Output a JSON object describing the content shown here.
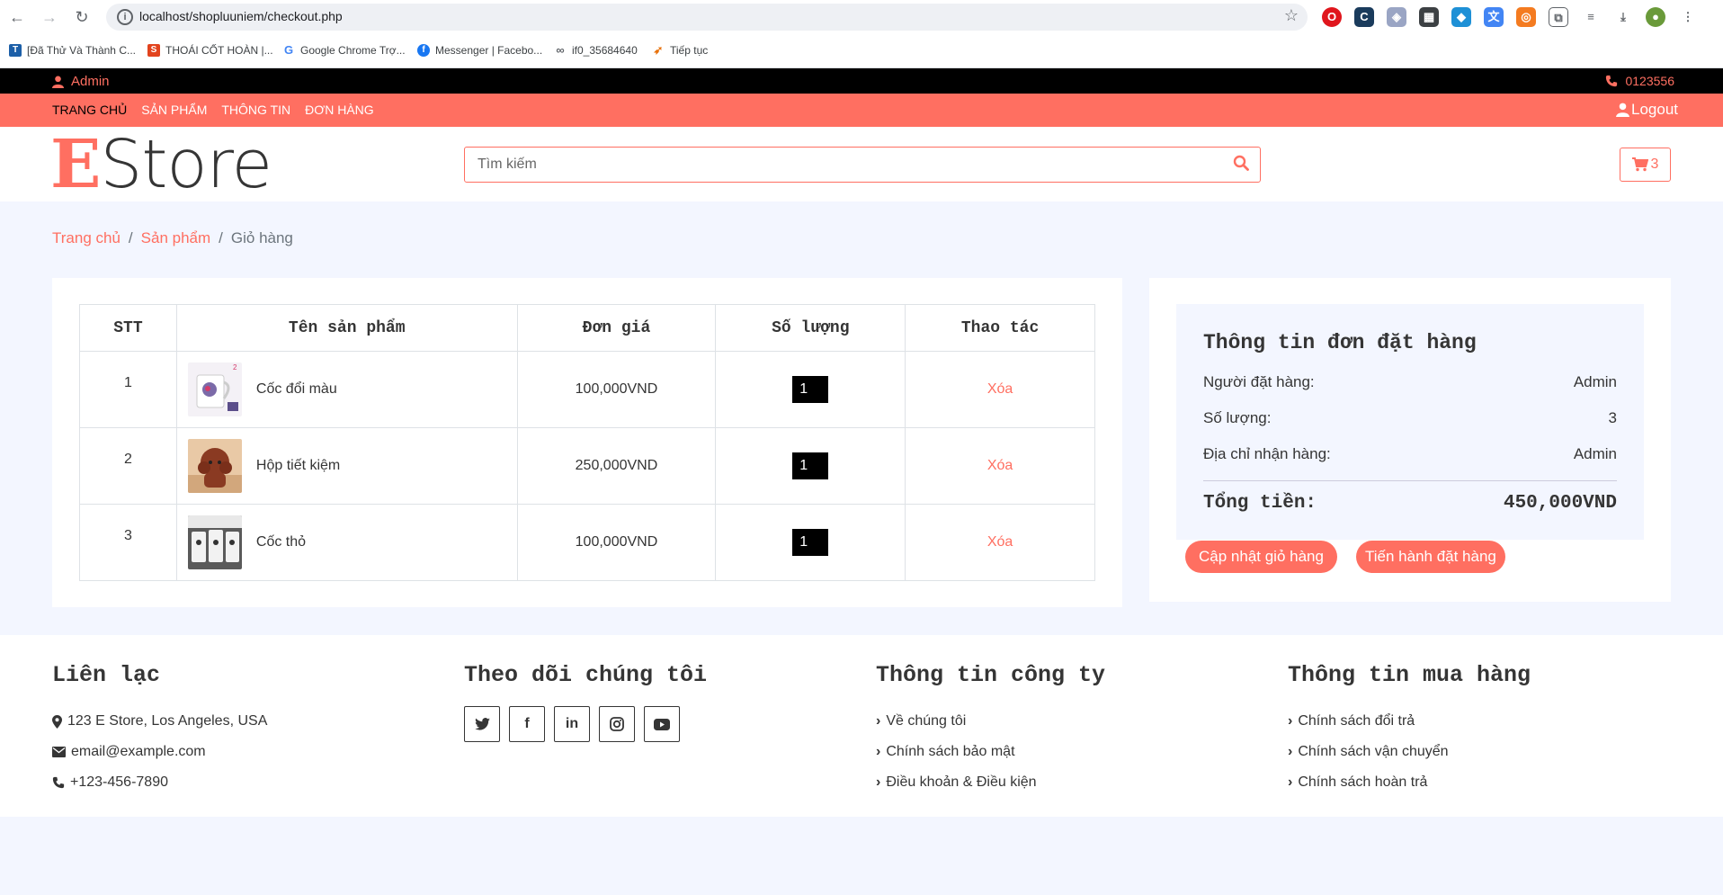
{
  "browser": {
    "url": "localhost/shopluuniem/checkout.php",
    "bookmarks": [
      "[Đã Thử Và Thành C...",
      "THOÁI CỐT HOÀN |...",
      "Google Chrome Trợ...",
      "Messenger | Facebo...",
      "if0_35684640",
      "Tiếp tục"
    ]
  },
  "topbar": {
    "user": "Admin",
    "phone": "0123556"
  },
  "nav": {
    "items": [
      "Trang chủ",
      "Sản phẩm",
      "Thông tin",
      "Đơn hàng"
    ],
    "logout": "Logout"
  },
  "brand": {
    "logo_first": "E",
    "logo_rest": "Store"
  },
  "search": {
    "placeholder": "Tìm kiếm"
  },
  "cart": {
    "count": "3"
  },
  "breadcrumb": {
    "home": "Trang chủ",
    "products": "Sản phẩm",
    "current": "Giỏ hàng",
    "sep": "/"
  },
  "table": {
    "headers": [
      "STT",
      "Tên sản phẩm",
      "Đơn giá",
      "Số lượng",
      "Thao tác"
    ],
    "rows": [
      {
        "stt": "1",
        "name": "Cốc đổi màu",
        "price": "100,000VND",
        "qty": "1",
        "action": "Xóa"
      },
      {
        "stt": "2",
        "name": "Hộp tiết kiệm",
        "price": "250,000VND",
        "qty": "1",
        "action": "Xóa"
      },
      {
        "stt": "3",
        "name": "Cốc thỏ",
        "price": "100,000VND",
        "qty": "1",
        "action": "Xóa"
      }
    ]
  },
  "summary": {
    "title": "Thông tin đơn đặt hàng",
    "buyer_label": "Người đặt hàng:",
    "buyer": "Admin",
    "qty_label": "Số lượng:",
    "qty": "3",
    "address_label": "Địa chỉ nhận hàng:",
    "address": "Admin",
    "total_label": "Tổng tiền:",
    "total": "450,000VND",
    "update_btn": "Cập nhật giỏ hàng",
    "order_btn": "Tiến hành đặt hàng"
  },
  "footer": {
    "contact": {
      "title": "Liên lạc",
      "address": "123 E Store, Los Angeles, USA",
      "email": "email@example.com",
      "phone": "+123-456-7890"
    },
    "follow": {
      "title": "Theo dõi chúng tôi"
    },
    "company": {
      "title": "Thông tin công ty",
      "links": [
        "Về chúng tôi",
        "Chính sách bảo mật",
        "Điều khoản & Điều kiện"
      ]
    },
    "purchase": {
      "title": "Thông tin mua hàng",
      "links": [
        "Chính sách đổi trả",
        "Chính sách vận chuyển",
        "Chính sách hoàn trả"
      ]
    }
  },
  "colors": {
    "accent": "#ff6f61",
    "bg_light": "#f3f6ff",
    "text": "#353535"
  }
}
